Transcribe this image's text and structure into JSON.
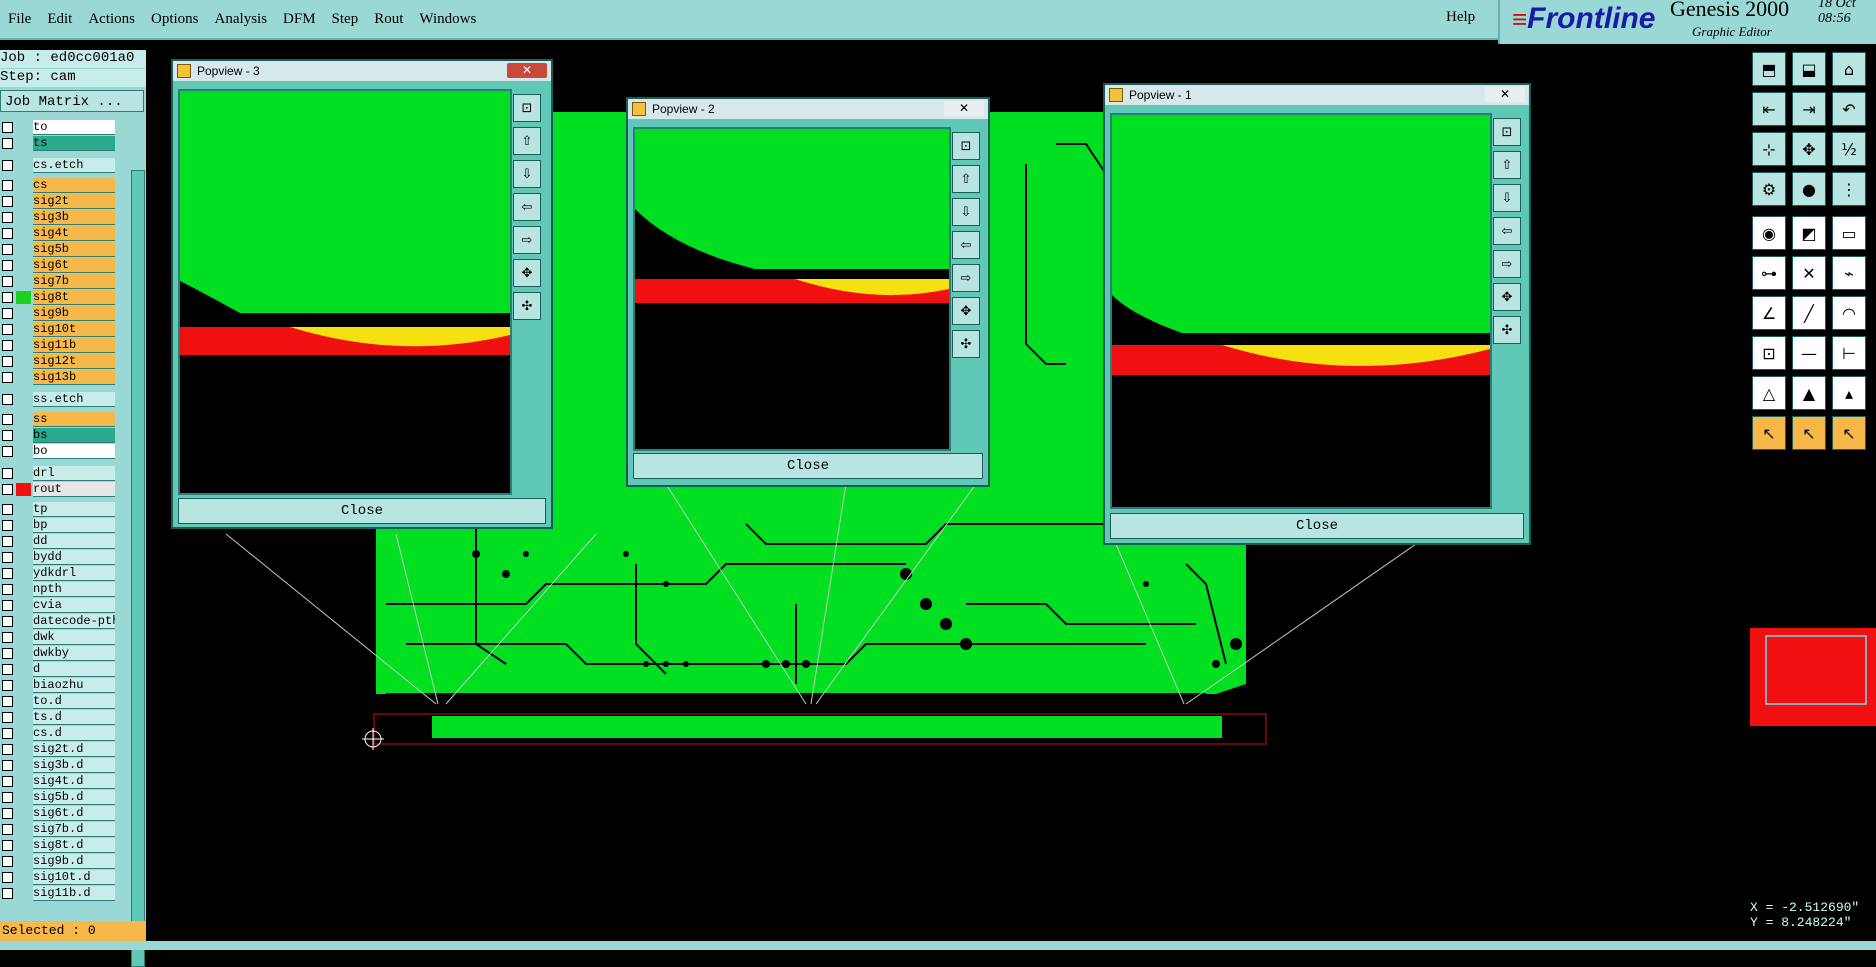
{
  "menu": [
    "File",
    "Edit",
    "Actions",
    "Options",
    "Analysis",
    "DFM",
    "Step",
    "Rout",
    "Windows"
  ],
  "help": "Help",
  "brand": {
    "logo": "Frontline",
    "product": "Genesis 2000",
    "subtitle": "Graphic Editor",
    "date": "18 Oct",
    "time": "08:56"
  },
  "job": {
    "job_label": "Job : ed0cc001a0",
    "step_label": "Step: cam",
    "matrix_button": "Job Matrix ..."
  },
  "layers": [
    {
      "name": "to",
      "color": "#ffffff"
    },
    {
      "name": "ts",
      "color": "#2aa98c"
    },
    {
      "name": "cs.etch",
      "color": "#c8ecea"
    },
    {
      "name": "cs",
      "color": "#f7b84a"
    },
    {
      "name": "sig2t",
      "color": "#f7b84a"
    },
    {
      "name": "sig3b",
      "color": "#f7b84a"
    },
    {
      "name": "sig4t",
      "color": "#f7b84a"
    },
    {
      "name": "sig5b",
      "color": "#f7b84a"
    },
    {
      "name": "sig6t",
      "color": "#f7b84a"
    },
    {
      "name": "sig7b",
      "color": "#f7b84a"
    },
    {
      "name": "sig8t",
      "color": "#f7b84a"
    },
    {
      "name": "sig9b",
      "color": "#f7b84a"
    },
    {
      "name": "sig10t",
      "color": "#f7b84a"
    },
    {
      "name": "sig11b",
      "color": "#f7b84a"
    },
    {
      "name": "sig12t",
      "color": "#f7b84a"
    },
    {
      "name": "sig13b",
      "color": "#f7b84a"
    },
    {
      "name": "ss.etch",
      "color": "#c8ecea"
    },
    {
      "name": "ss",
      "color": "#f7b84a"
    },
    {
      "name": "bs",
      "color": "#2aa98c"
    },
    {
      "name": "bo",
      "color": "#ffffff"
    },
    {
      "name": "drl",
      "color": "#c8ecea"
    },
    {
      "name": "rout",
      "color": "#e6e6e6"
    },
    {
      "name": "tp",
      "color": "#c8ecea"
    },
    {
      "name": "bp",
      "color": "#c8ecea"
    },
    {
      "name": "dd",
      "color": "#c8ecea"
    },
    {
      "name": "bydd",
      "color": "#c8ecea"
    },
    {
      "name": "ydkdrl",
      "color": "#c8ecea"
    },
    {
      "name": "npth",
      "color": "#c8ecea"
    },
    {
      "name": "cvia",
      "color": "#c8ecea"
    },
    {
      "name": "datecode-pth",
      "color": "#c8ecea"
    },
    {
      "name": "dwk",
      "color": "#c8ecea"
    },
    {
      "name": "dwkby",
      "color": "#c8ecea"
    },
    {
      "name": "d",
      "color": "#c8ecea"
    },
    {
      "name": "biaozhu",
      "color": "#c8ecea"
    },
    {
      "name": "to.d",
      "color": "#c8ecea"
    },
    {
      "name": "ts.d",
      "color": "#c8ecea"
    },
    {
      "name": "cs.d",
      "color": "#c8ecea"
    },
    {
      "name": "sig2t.d",
      "color": "#c8ecea"
    },
    {
      "name": "sig3b.d",
      "color": "#c8ecea"
    },
    {
      "name": "sig4t.d",
      "color": "#c8ecea"
    },
    {
      "name": "sig5b.d",
      "color": "#c8ecea"
    },
    {
      "name": "sig6t.d",
      "color": "#c8ecea"
    },
    {
      "name": "sig7b.d",
      "color": "#c8ecea"
    },
    {
      "name": "sig8t.d",
      "color": "#c8ecea"
    },
    {
      "name": "sig9b.d",
      "color": "#c8ecea"
    },
    {
      "name": "sig10t.d",
      "color": "#c8ecea"
    },
    {
      "name": "sig11b.d",
      "color": "#c8ecea"
    }
  ],
  "selected": "Selected : 0",
  "popviews": [
    {
      "title": "Popview - 3",
      "close": "Close"
    },
    {
      "title": "Popview - 2",
      "close": "Close"
    },
    {
      "title": "Popview - 1",
      "close": "Close"
    }
  ],
  "coords": {
    "x": "X = -2.512690\"",
    "y": "Y = 8.248224\""
  },
  "colors": {
    "board": "#00e020",
    "accent_panel": "#9ad8d6",
    "highlight": "#f01010"
  }
}
